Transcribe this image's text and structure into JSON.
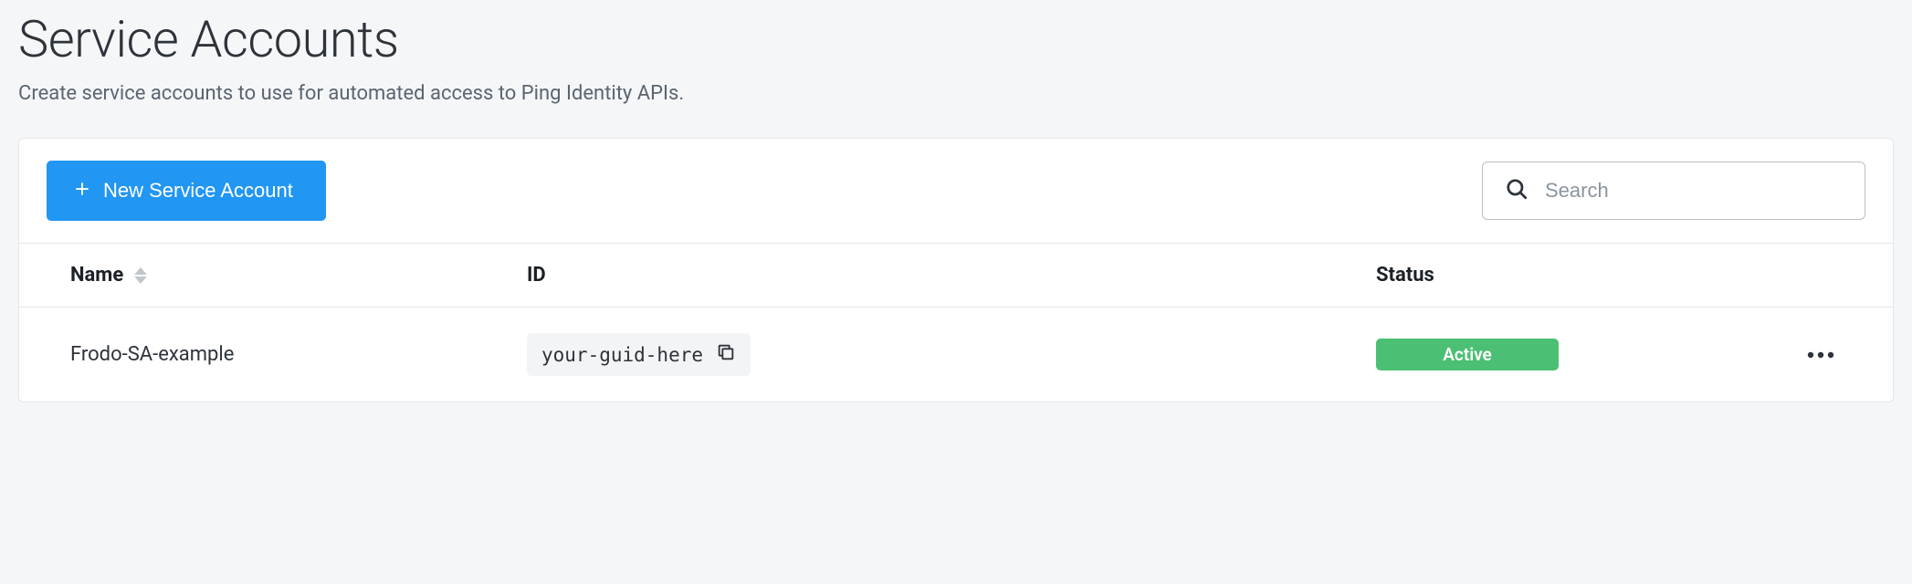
{
  "page": {
    "title": "Service Accounts",
    "subtitle": "Create service accounts to use for automated access to Ping Identity APIs."
  },
  "toolbar": {
    "new_button_label": "New Service Account",
    "search_placeholder": "Search"
  },
  "table": {
    "columns": {
      "name": "Name",
      "id": "ID",
      "status": "Status"
    },
    "rows": [
      {
        "name": "Frodo-SA-example",
        "id": "your-guid-here",
        "status": "Active"
      }
    ]
  },
  "colors": {
    "primary": "#2196f3",
    "success": "#4bbf73"
  }
}
